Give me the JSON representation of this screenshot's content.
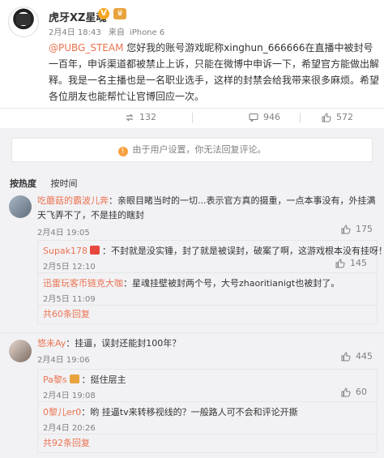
{
  "post": {
    "username": "虎牙XZ星魂",
    "verified_badge": "V",
    "date": "2月4日 18:43",
    "source_prefix": "来自",
    "source": "iPhone 6",
    "mention": "@PUBG_STEAM",
    "text": " 您好我的账号游戏昵称xinghun_666666在直播中被封号一百年，申诉渠道都被禁止上诉，只能在微博中申诉一下，希望官方能做出解释。我是一名主播也是一名职业选手，这样的封禁会给我带来很多麻烦。希望各位朋友也能帮忙让官博回应一次。"
  },
  "actions": {
    "repost_count": "132",
    "comment_count": "946",
    "like_count": "572"
  },
  "restriction_notice": "由于用户设置，你无法回复评论。",
  "sort": {
    "hot": "按热度",
    "time": "按时间"
  },
  "comments": [
    {
      "user": "吃蘑菇的霸波儿奔",
      "text": "：亲眼目睹当时的一切...表示官方真的摄重，一点本事没有，外挂满天飞弄不了，不是挂的瞎封",
      "time": "2月4日 19:05",
      "likes": "175",
      "replies": [
        {
          "user": "Supak178",
          "text": "：不封就是没实锤，封了就是被误封，破案了啊，这游戏根本没有挂呀！",
          "time": "2月5日 12:10",
          "likes": "145"
        },
        {
          "user": "迅雷玩客币链克大咖",
          "text": "：星魂挂壁被封两个号，大号zhaoritianigt也被封了。",
          "time": "2月5日 11:09",
          "likes": ""
        }
      ],
      "more": "共60条回复"
    },
    {
      "user": "悠未Ay",
      "text": "：挂逼，误封还能封100年？",
      "time": "2月4日 19:06",
      "likes": "445",
      "replies": [
        {
          "user": "Pa黎s",
          "text": "：挺住层主",
          "time": "2月4日 19:08",
          "likes": "60"
        },
        {
          "user": "0黎儿er0",
          "text": "：哟 挂逼tv来转移视线的？一般路人可不会和评论开撕",
          "time": "2月4日 20:26",
          "likes": ""
        }
      ],
      "more": "共92条回复"
    }
  ],
  "colors": {
    "link": "#eb7350",
    "muted": "#808080",
    "panel": "#f2f2f5"
  }
}
